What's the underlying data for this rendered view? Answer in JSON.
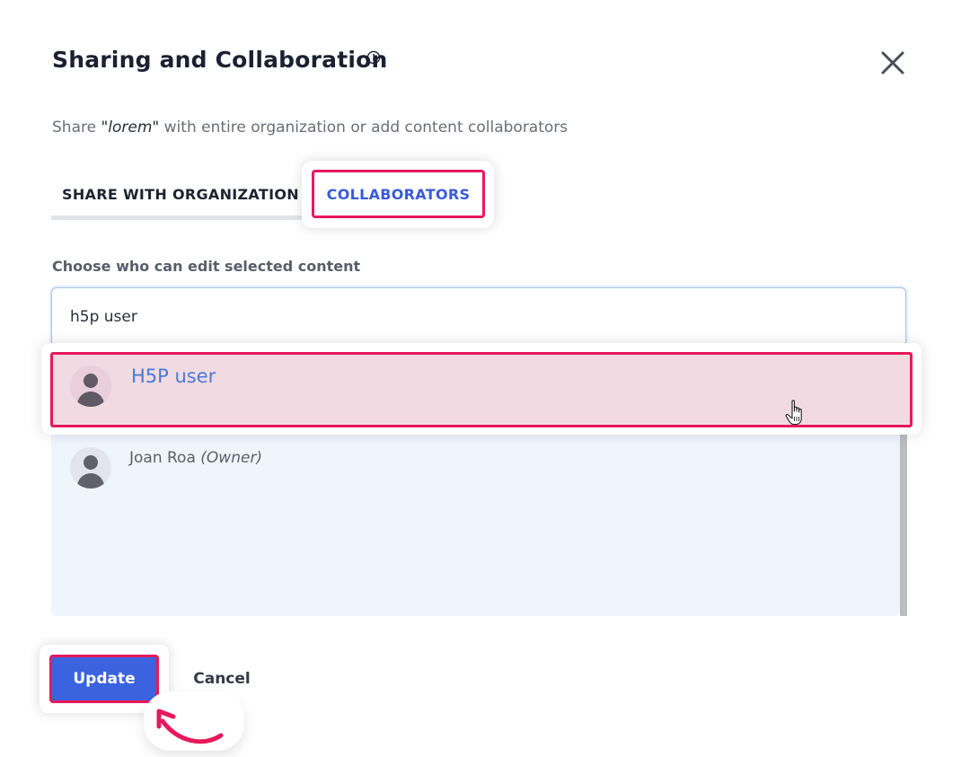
{
  "dialog": {
    "title": "Sharing and Collaboration",
    "subtitle_prefix": "Share ",
    "content_name": "\"lorem\"",
    "subtitle_suffix": " with entire organization or add content collaborators"
  },
  "tabs": [
    {
      "label": "SHARE WITH ORGANIZATION",
      "active": false
    },
    {
      "label": "COLLABORATORS",
      "active": true
    }
  ],
  "collaborators": {
    "field_label": "Choose who can edit selected content",
    "search_value": "h5p user",
    "suggestion": {
      "name": "H5P user"
    },
    "list": [
      {
        "name": "Joan Roa",
        "role": "(Owner)"
      }
    ]
  },
  "actions": {
    "update_label": "Update",
    "cancel_label": "Cancel"
  },
  "colors": {
    "accent": "#3b63e0",
    "highlight": "#e8185c",
    "link": "#4a7bd6"
  },
  "icons": [
    "info-icon",
    "close-icon",
    "user-avatar-icon",
    "hand-pointer-icon",
    "curved-arrow-icon"
  ]
}
